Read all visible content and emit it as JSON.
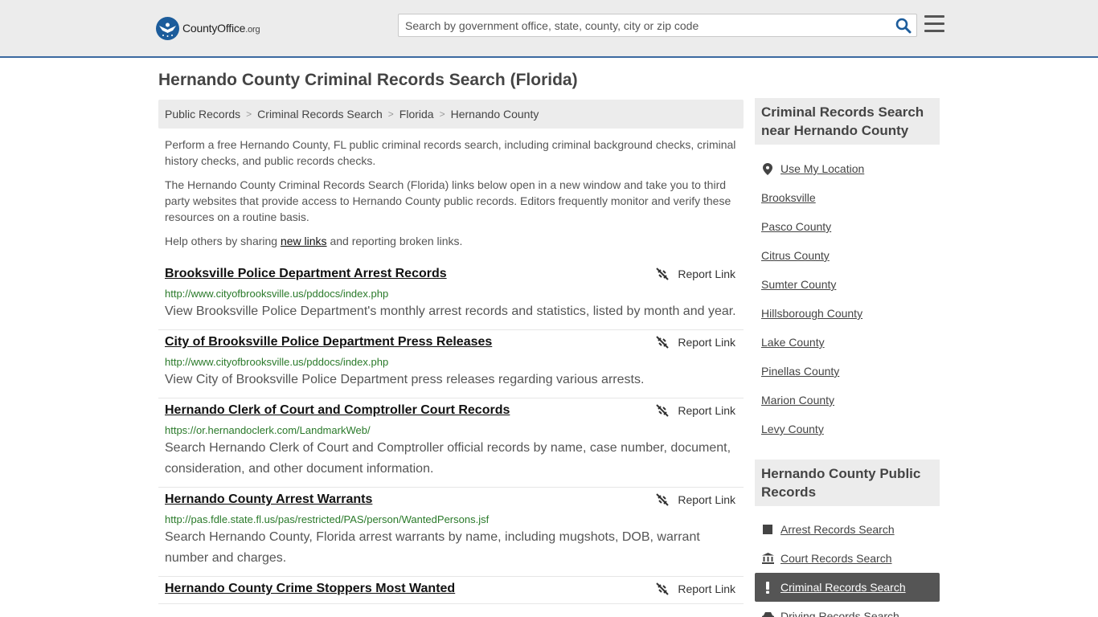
{
  "header": {
    "logo_text": "CountyOffice",
    "logo_suffix": ".org",
    "search_placeholder": "Search by government office, state, county, city or zip code"
  },
  "page": {
    "title": "Hernando County Criminal Records Search (Florida)"
  },
  "breadcrumb": [
    "Public Records",
    "Criminal Records Search",
    "Florida",
    "Hernando County"
  ],
  "intro": {
    "p1": "Perform a free Hernando County, FL public criminal records search, including criminal background checks, criminal history checks, and public records checks.",
    "p2": "The Hernando County Criminal Records Search (Florida) links below open in a new window and take you to third party websites that provide access to Hernando County public records. Editors frequently monitor and verify these resources on a routine basis.",
    "p3_before": "Help others by sharing ",
    "p3_link": "new links",
    "p3_after": " and reporting broken links."
  },
  "report_label": "Report Link",
  "records": [
    {
      "title": "Brooksville Police Department Arrest Records",
      "url": "http://www.cityofbrooksville.us/pddocs/index.php",
      "desc": "View Brooksville Police Department's monthly arrest records and statistics, listed by month and year."
    },
    {
      "title": "City of Brooksville Police Department Press Releases",
      "url": "http://www.cityofbrooksville.us/pddocs/index.php",
      "desc": "View City of Brooksville Police Department press releases regarding various arrests."
    },
    {
      "title": "Hernando Clerk of Court and Comptroller Court Records",
      "url": "https://or.hernandoclerk.com/LandmarkWeb/",
      "desc": "Search Hernando Clerk of Court and Comptroller official records by name, case number, document, consideration, and other document information."
    },
    {
      "title": "Hernando County Arrest Warrants",
      "url": "http://pas.fdle.state.fl.us/pas/restricted/PAS/person/WantedPersons.jsf",
      "desc": "Search Hernando County, Florida arrest warrants by name, including mugshots, DOB, warrant number and charges."
    },
    {
      "title": "Hernando County Crime Stoppers Most Wanted",
      "url": "",
      "desc": ""
    }
  ],
  "sidebar": {
    "nearby_heading": "Criminal Records Search near Hernando County",
    "use_location": "Use My Location",
    "nearby": [
      "Brooksville",
      "Pasco County",
      "Citrus County",
      "Sumter County",
      "Hillsborough County",
      "Lake County",
      "Pinellas County",
      "Marion County",
      "Levy County"
    ],
    "public_heading": "Hernando County Public Records",
    "public_items": [
      {
        "label": "Arrest Records Search",
        "icon": "square-icon"
      },
      {
        "label": "Court Records Search",
        "icon": "courthouse-icon"
      },
      {
        "label": "Criminal Records Search",
        "icon": "exclamation-icon"
      },
      {
        "label": "Driving Records Search",
        "icon": "car-icon"
      }
    ]
  },
  "colors": {
    "accent_border": "#3b6aa0",
    "url_green": "#2a7a2a",
    "active_bg": "#555555"
  }
}
